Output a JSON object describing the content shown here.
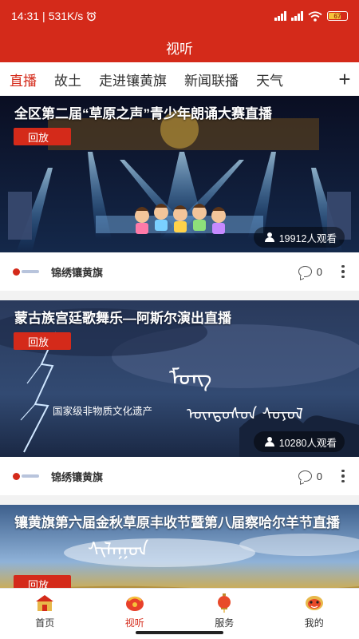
{
  "status": {
    "time": "14:31",
    "speed": "531K/s",
    "battery": "67"
  },
  "title": "视听",
  "tabs": [
    {
      "label": "直播",
      "active": true
    },
    {
      "label": "故土",
      "active": false
    },
    {
      "label": "走进镶黄旗",
      "active": false
    },
    {
      "label": "新闻联播",
      "active": false
    },
    {
      "label": "天气",
      "active": false
    }
  ],
  "add_tab": "+",
  "cards": [
    {
      "title": "全区第二届“草原之声”青少年朗诵大赛直播",
      "replay": "回放",
      "viewers": "19912人观看",
      "source": "锦绣镶黄旗",
      "comments": "0",
      "image": "stage-icon"
    },
    {
      "title": "蒙古族宫廷歌舞乐—阿斯尔演出直播",
      "replay": "回放",
      "viewers": "10280人观看",
      "source": "锦绣镶黄旗",
      "comments": "0",
      "overlay_text": "国家级非物质文化遗产",
      "image": "storm-icon"
    },
    {
      "title": "镶黄旗第六届金秋草原丰收节暨第八届察哈尔羊节直播",
      "replay": "回放",
      "image": "grassland-icon"
    }
  ],
  "nav": [
    {
      "label": "首页",
      "icon": "home-icon",
      "active": false
    },
    {
      "label": "视听",
      "icon": "media-icon",
      "active": true
    },
    {
      "label": "服务",
      "icon": "lantern-icon",
      "active": false
    },
    {
      "label": "我的",
      "icon": "lion-icon",
      "active": false
    }
  ],
  "colors": {
    "brand": "#d42a1a",
    "text": "#333333"
  }
}
